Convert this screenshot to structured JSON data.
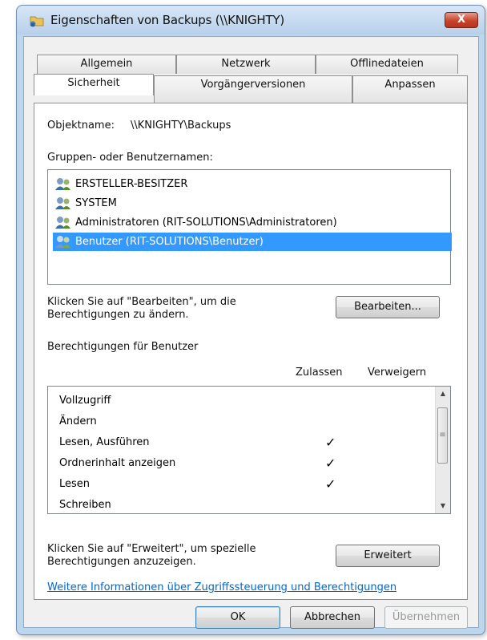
{
  "window": {
    "title": "Eigenschaften von Backups (\\\\KNIGHTY)",
    "close_label": "X"
  },
  "tabs_row1": [
    "Allgemein",
    "Netzwerk",
    "Offlinedateien"
  ],
  "tabs_row2": [
    "Sicherheit",
    "Vorgängerversionen",
    "Anpassen"
  ],
  "selected_tab": "Sicherheit",
  "security": {
    "object_label": "Objektname:",
    "object_value": "\\\\KNIGHTY\\Backups",
    "groups_label": "Gruppen- oder Benutzernamen:",
    "groups": [
      {
        "name": "ERSTELLER-BESITZER",
        "icon": "users-icon"
      },
      {
        "name": "SYSTEM",
        "icon": "users-icon"
      },
      {
        "name": "Administratoren (RIT-SOLUTIONS\\Administratoren)",
        "icon": "users-icon"
      },
      {
        "name": "Benutzer (RIT-SOLUTIONS\\Benutzer)",
        "icon": "users-icon"
      }
    ],
    "selected_group": "Benutzer (RIT-SOLUTIONS\\Benutzer)",
    "edit_hint_line1": "Klicken Sie auf \"Bearbeiten\", um die",
    "edit_hint_line2": "Berechtigungen zu ändern.",
    "edit_button": "Bearbeiten...",
    "permissions_label": "Berechtigungen für Benutzer",
    "col_allow": "Zulassen",
    "col_deny": "Verweigern",
    "permissions": [
      {
        "name": "Vollzugriff",
        "allow": "",
        "deny": ""
      },
      {
        "name": "Ändern",
        "allow": "",
        "deny": ""
      },
      {
        "name": "Lesen, Ausführen",
        "allow": "✓",
        "deny": ""
      },
      {
        "name": "Ordnerinhalt anzeigen",
        "allow": "✓",
        "deny": ""
      },
      {
        "name": "Lesen",
        "allow": "✓",
        "deny": ""
      },
      {
        "name": "Schreiben",
        "allow": "",
        "deny": ""
      }
    ],
    "advanced_hint_line1": "Klicken Sie auf \"Erweitert\", um spezielle",
    "advanced_hint_line2": "Berechtigungen anzuzeigen.",
    "advanced_button": "Erweitert",
    "info_link": "Weitere Informationen über Zugriffssteuerung und Berechtigungen"
  },
  "footer": {
    "ok": "OK",
    "cancel": "Abbrechen",
    "apply": "Übernehmen"
  }
}
